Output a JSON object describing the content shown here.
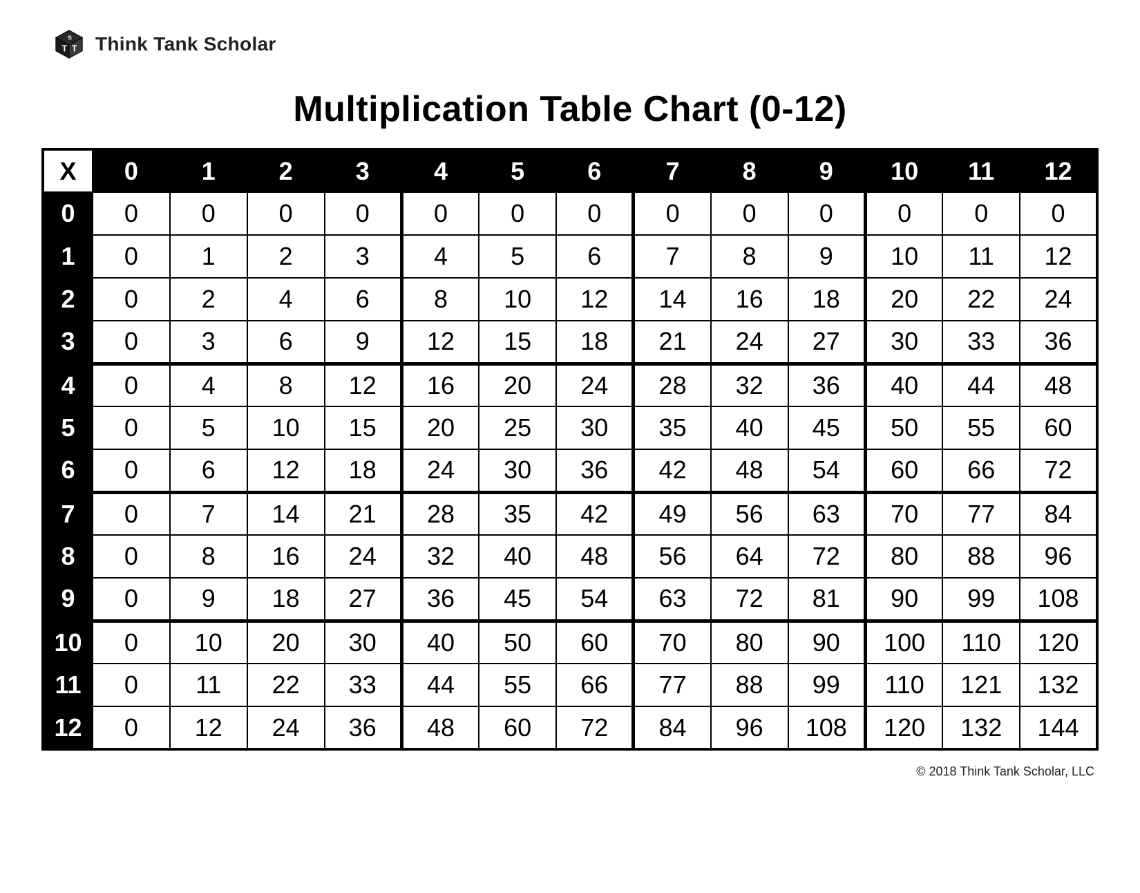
{
  "brand": "Think Tank Scholar",
  "title": "Multiplication Table Chart (0-12)",
  "corner": "X",
  "col_headers": [
    "0",
    "1",
    "2",
    "3",
    "4",
    "5",
    "6",
    "7",
    "8",
    "9",
    "10",
    "11",
    "12"
  ],
  "row_headers": [
    "0",
    "1",
    "2",
    "3",
    "4",
    "5",
    "6",
    "7",
    "8",
    "9",
    "10",
    "11",
    "12"
  ],
  "cells": [
    [
      "0",
      "0",
      "0",
      "0",
      "0",
      "0",
      "0",
      "0",
      "0",
      "0",
      "0",
      "0",
      "0"
    ],
    [
      "0",
      "1",
      "2",
      "3",
      "4",
      "5",
      "6",
      "7",
      "8",
      "9",
      "10",
      "11",
      "12"
    ],
    [
      "0",
      "2",
      "4",
      "6",
      "8",
      "10",
      "12",
      "14",
      "16",
      "18",
      "20",
      "22",
      "24"
    ],
    [
      "0",
      "3",
      "6",
      "9",
      "12",
      "15",
      "18",
      "21",
      "24",
      "27",
      "30",
      "33",
      "36"
    ],
    [
      "0",
      "4",
      "8",
      "12",
      "16",
      "20",
      "24",
      "28",
      "32",
      "36",
      "40",
      "44",
      "48"
    ],
    [
      "0",
      "5",
      "10",
      "15",
      "20",
      "25",
      "30",
      "35",
      "40",
      "45",
      "50",
      "55",
      "60"
    ],
    [
      "0",
      "6",
      "12",
      "18",
      "24",
      "30",
      "36",
      "42",
      "48",
      "54",
      "60",
      "66",
      "72"
    ],
    [
      "0",
      "7",
      "14",
      "21",
      "28",
      "35",
      "42",
      "49",
      "56",
      "63",
      "70",
      "77",
      "84"
    ],
    [
      "0",
      "8",
      "16",
      "24",
      "32",
      "40",
      "48",
      "56",
      "64",
      "72",
      "80",
      "88",
      "96"
    ],
    [
      "0",
      "9",
      "18",
      "27",
      "36",
      "45",
      "54",
      "63",
      "72",
      "81",
      "90",
      "99",
      "108"
    ],
    [
      "0",
      "10",
      "20",
      "30",
      "40",
      "50",
      "60",
      "70",
      "80",
      "90",
      "100",
      "110",
      "120"
    ],
    [
      "0",
      "11",
      "22",
      "33",
      "44",
      "55",
      "66",
      "77",
      "88",
      "99",
      "110",
      "121",
      "132"
    ],
    [
      "0",
      "12",
      "24",
      "36",
      "48",
      "60",
      "72",
      "84",
      "96",
      "108",
      "120",
      "132",
      "144"
    ]
  ],
  "footer": "© 2018 Think Tank Scholar, LLC"
}
